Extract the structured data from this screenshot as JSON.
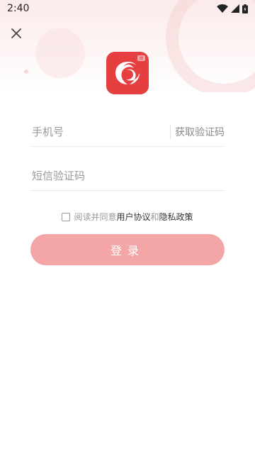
{
  "status_bar": {
    "time": "2:40",
    "icons": [
      "wifi-icon",
      "signal-icon",
      "battery-icon"
    ]
  },
  "header": {
    "close_icon": "close-icon",
    "logo": "app-logo"
  },
  "form": {
    "phone_placeholder": "手机号",
    "phone_value": "",
    "get_code_label": "获取验证码",
    "sms_placeholder": "短信验证码",
    "sms_value": ""
  },
  "agreement": {
    "checked": false,
    "prefix": "阅读并同意",
    "user_agreement": "用户协议",
    "and": "和",
    "privacy_policy": "隐私政策"
  },
  "login_button": {
    "label": "登录"
  },
  "colors": {
    "brand_red": "#e53f3f",
    "button_pink": "#f4a5a5",
    "placeholder_gray": "#9a9a9a"
  }
}
